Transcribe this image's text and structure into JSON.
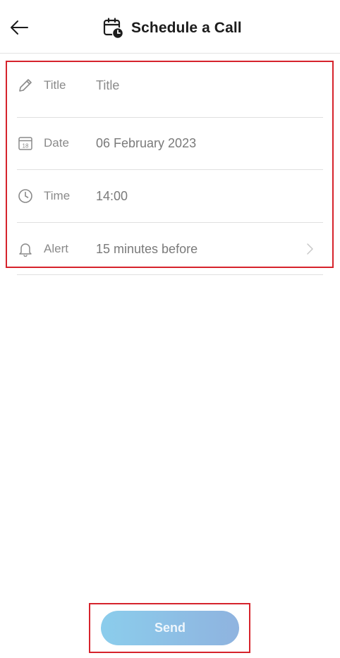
{
  "header": {
    "title": "Schedule a Call",
    "back_icon": "arrow-left-icon",
    "title_icon": "calendar-clock-icon"
  },
  "form": {
    "title": {
      "label": "Title",
      "placeholder": "Title",
      "icon": "pencil-icon"
    },
    "date": {
      "label": "Date",
      "value": "06 February 2023",
      "icon": "calendar-icon",
      "icon_day": "18"
    },
    "time": {
      "label": "Time",
      "value": "14:00",
      "icon": "clock-icon"
    },
    "alert": {
      "label": "Alert",
      "value": "15 minutes before",
      "icon": "bell-icon"
    }
  },
  "send": {
    "label": "Send"
  },
  "colors": {
    "annotation": "#d6232c",
    "send_gradient_start": "#8bcdec",
    "send_gradient_end": "#8fb3df"
  }
}
